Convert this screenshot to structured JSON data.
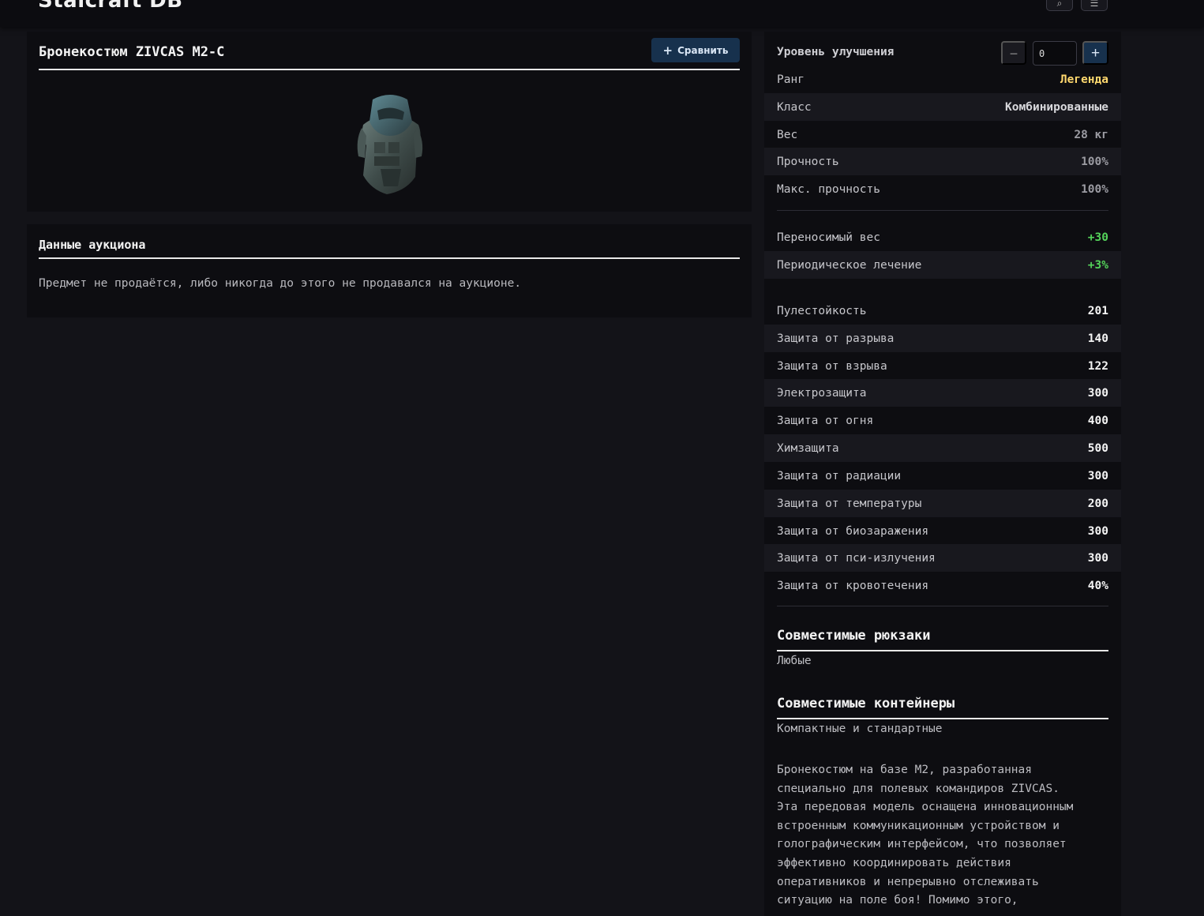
{
  "header": {
    "logo": "Stalcraft DB",
    "search_icon": "search-icon",
    "menu_icon": "menu-icon"
  },
  "item": {
    "name": "Бронекостюм ZIVCAS M2-C",
    "compare_label": "Сравнить",
    "image_icon": "armor-suit-icon"
  },
  "auction": {
    "title": "Данные аукциона",
    "text": "Предмет не продаётся, либо никогда до этого не продавался на аукционе."
  },
  "upgrade": {
    "label": "Уровень улучшения",
    "value": "0",
    "minus": "−",
    "plus": "+"
  },
  "base_stats": [
    {
      "label": "Ранг",
      "value": "Легенда",
      "tone": "gold"
    },
    {
      "label": "Класс",
      "value": "Комбинированные",
      "tone": "light"
    },
    {
      "label": "Вес",
      "value": "28 кг",
      "tone": "gray"
    },
    {
      "label": "Прочность",
      "value": "100%",
      "tone": "gray"
    },
    {
      "label": "Макс. прочность",
      "value": "100%",
      "tone": "gray"
    }
  ],
  "bonus_stats": [
    {
      "label": "Переносимый вес",
      "value": "+30",
      "tone": "green"
    },
    {
      "label": "Периодическое лечение",
      "value": "+3%",
      "tone": "green"
    }
  ],
  "protection_stats": [
    {
      "label": "Пулестойкость",
      "value": "201"
    },
    {
      "label": "Защита от разрыва",
      "value": "140"
    },
    {
      "label": "Защита от взрыва",
      "value": "122"
    },
    {
      "label": "Электрозащита",
      "value": "300"
    },
    {
      "label": "Защита от огня",
      "value": "400"
    },
    {
      "label": "Химзащита",
      "value": "500"
    },
    {
      "label": "Защита от радиации",
      "value": "300"
    },
    {
      "label": "Защита от температуры",
      "value": "200"
    },
    {
      "label": "Защита от биозаражения",
      "value": "300"
    },
    {
      "label": "Защита от пси-излучения",
      "value": "300"
    },
    {
      "label": "Защита от кровотечения",
      "value": "40%"
    }
  ],
  "backpacks": {
    "title": "Совместимые рюкзаки",
    "value": "Любые"
  },
  "containers": {
    "title": "Совместимые контейнеры",
    "value": "Компактные и стандартные"
  },
  "description": "Бронекостюм на базе M2, разработанная\nспециально для полевых командиров ZIVCAS.\nЭта передовая модель оснащена инновационным\nвстроенным коммуникационным устройством и\nголографическим интерфейсом, что позволяет\nэффективно координировать действия\nоперативников и непрерывно отслеживать\nситуацию на поле боя! Помимо этого,"
}
